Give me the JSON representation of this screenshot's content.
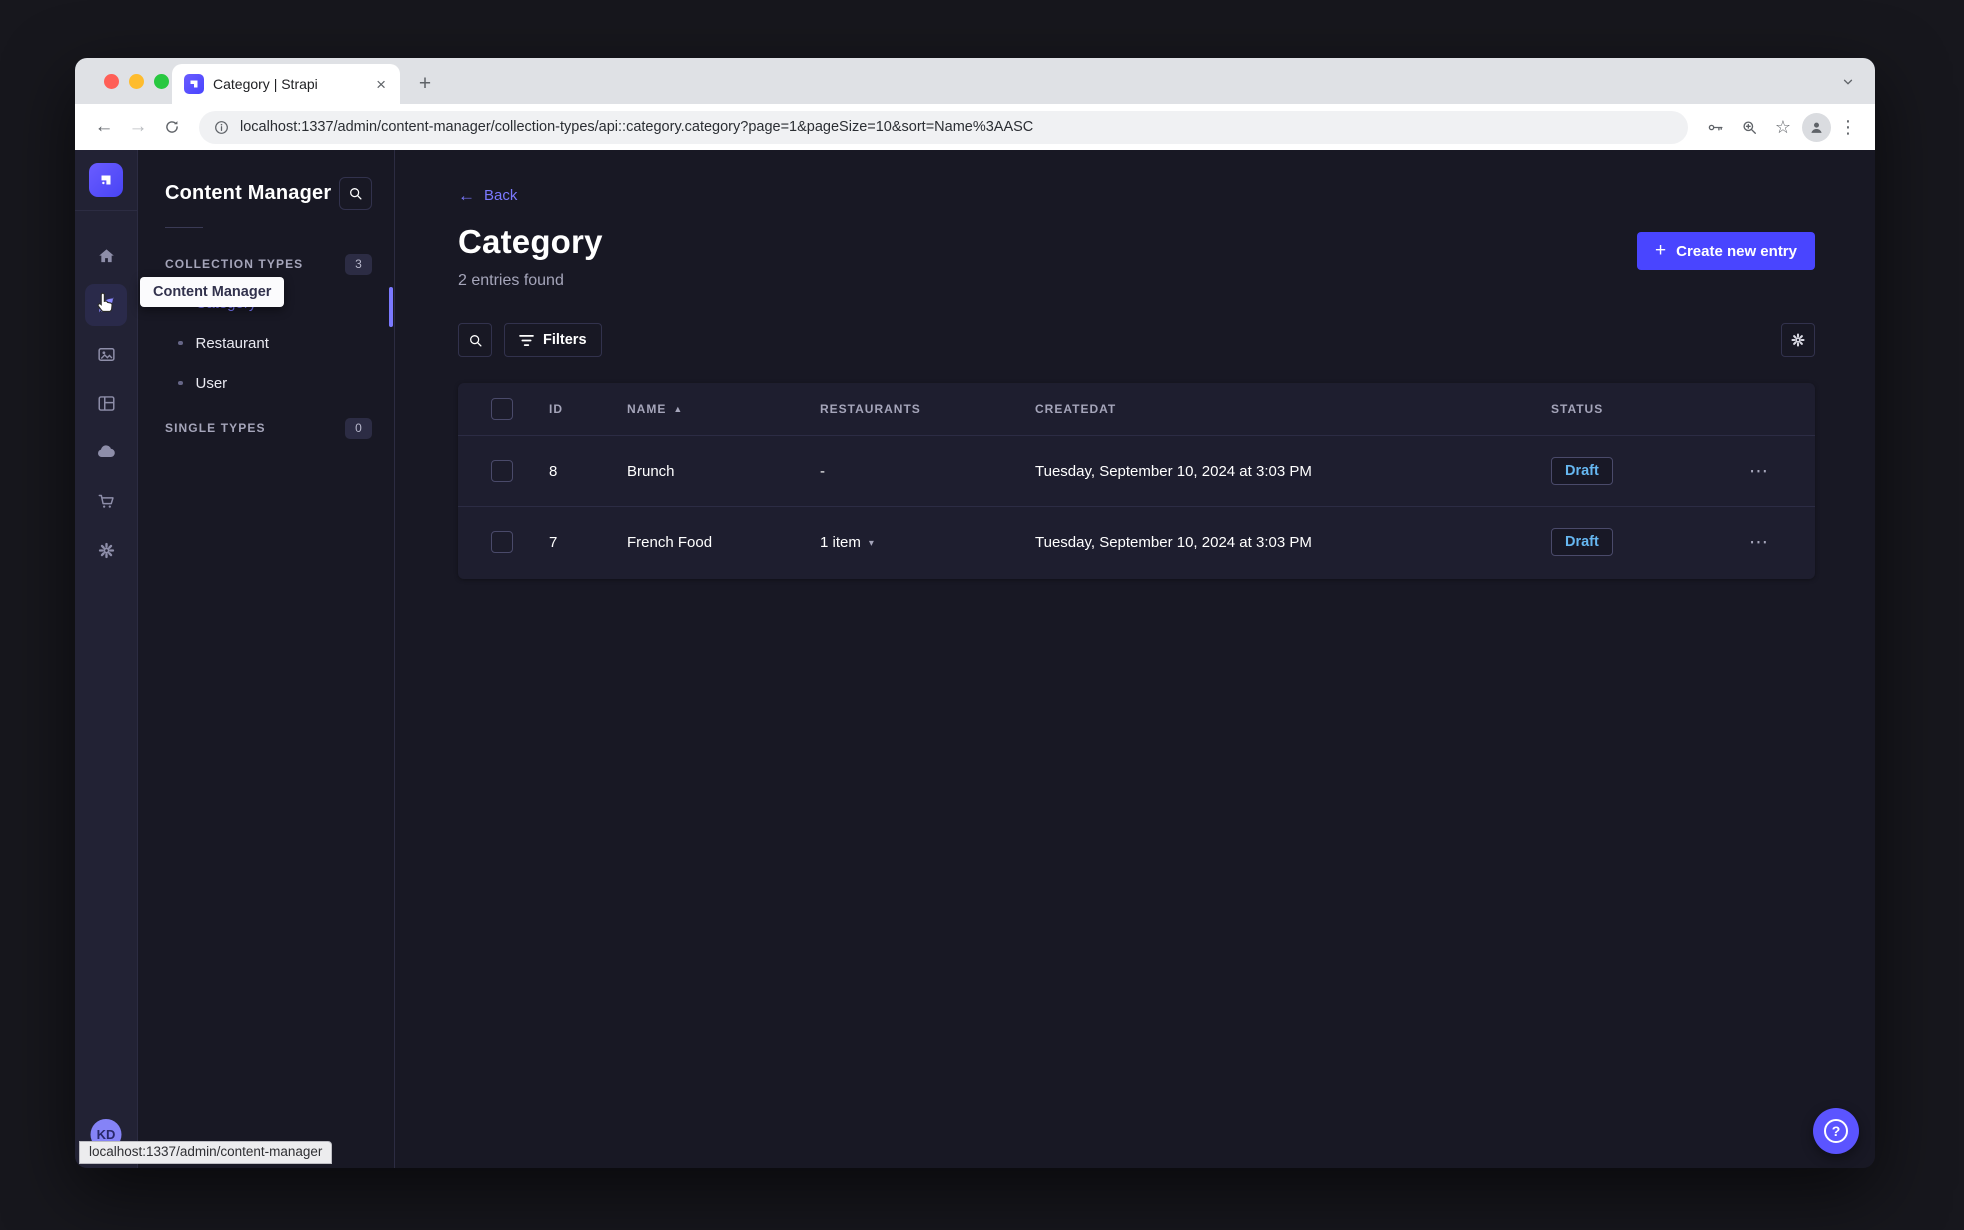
{
  "browser": {
    "tab_title": "Category | Strapi",
    "url": "localhost:1337/admin/content-manager/collection-types/api::category.category?page=1&pageSize=10&sort=Name%3AASC"
  },
  "glyphs": {
    "close": "×",
    "new_tab": "+",
    "back_arrow": "←",
    "forward_arrow": "→",
    "star": "☆",
    "kebab": "⋮",
    "plus": "+",
    "sort_asc": "▲",
    "chevron_down": "▾",
    "row_menu": "⋯",
    "question": "?"
  },
  "nav_tooltip": "Content Manager",
  "subnav": {
    "title": "Content Manager",
    "collection_section": {
      "label": "COLLECTION TYPES",
      "count": "3"
    },
    "items": [
      {
        "label": "Category"
      },
      {
        "label": "Restaurant"
      },
      {
        "label": "User"
      }
    ],
    "single_section": {
      "label": "SINGLE TYPES",
      "count": "0"
    }
  },
  "header": {
    "back": "Back",
    "title": "Category",
    "subtitle": "2 entries found",
    "create_button": "Create new entry"
  },
  "filters": {
    "label": "Filters"
  },
  "table": {
    "headers": {
      "id": "ID",
      "name": "NAME",
      "restaurants": "RESTAURANTS",
      "createdat": "CREATEDAT",
      "status": "STATUS"
    },
    "rows": [
      {
        "id": "8",
        "name": "Brunch",
        "restaurants": "-",
        "createdat": "Tuesday, September 10, 2024 at 3:03 PM",
        "status": "Draft"
      },
      {
        "id": "7",
        "name": "French Food",
        "restaurants": "1 item",
        "createdat": "Tuesday, September 10, 2024 at 3:03 PM",
        "status": "Draft"
      }
    ]
  },
  "footer": {
    "status_url": "localhost:1337/admin/content-manager",
    "avatar_initials": "KD"
  },
  "colors": {
    "primary": "#4945ff",
    "primary_light": "#7b79ff",
    "draft_text": "#66b7f1",
    "app_bg": "#181824",
    "panel_bg": "#222234",
    "table_bg": "#1e1e2f"
  }
}
